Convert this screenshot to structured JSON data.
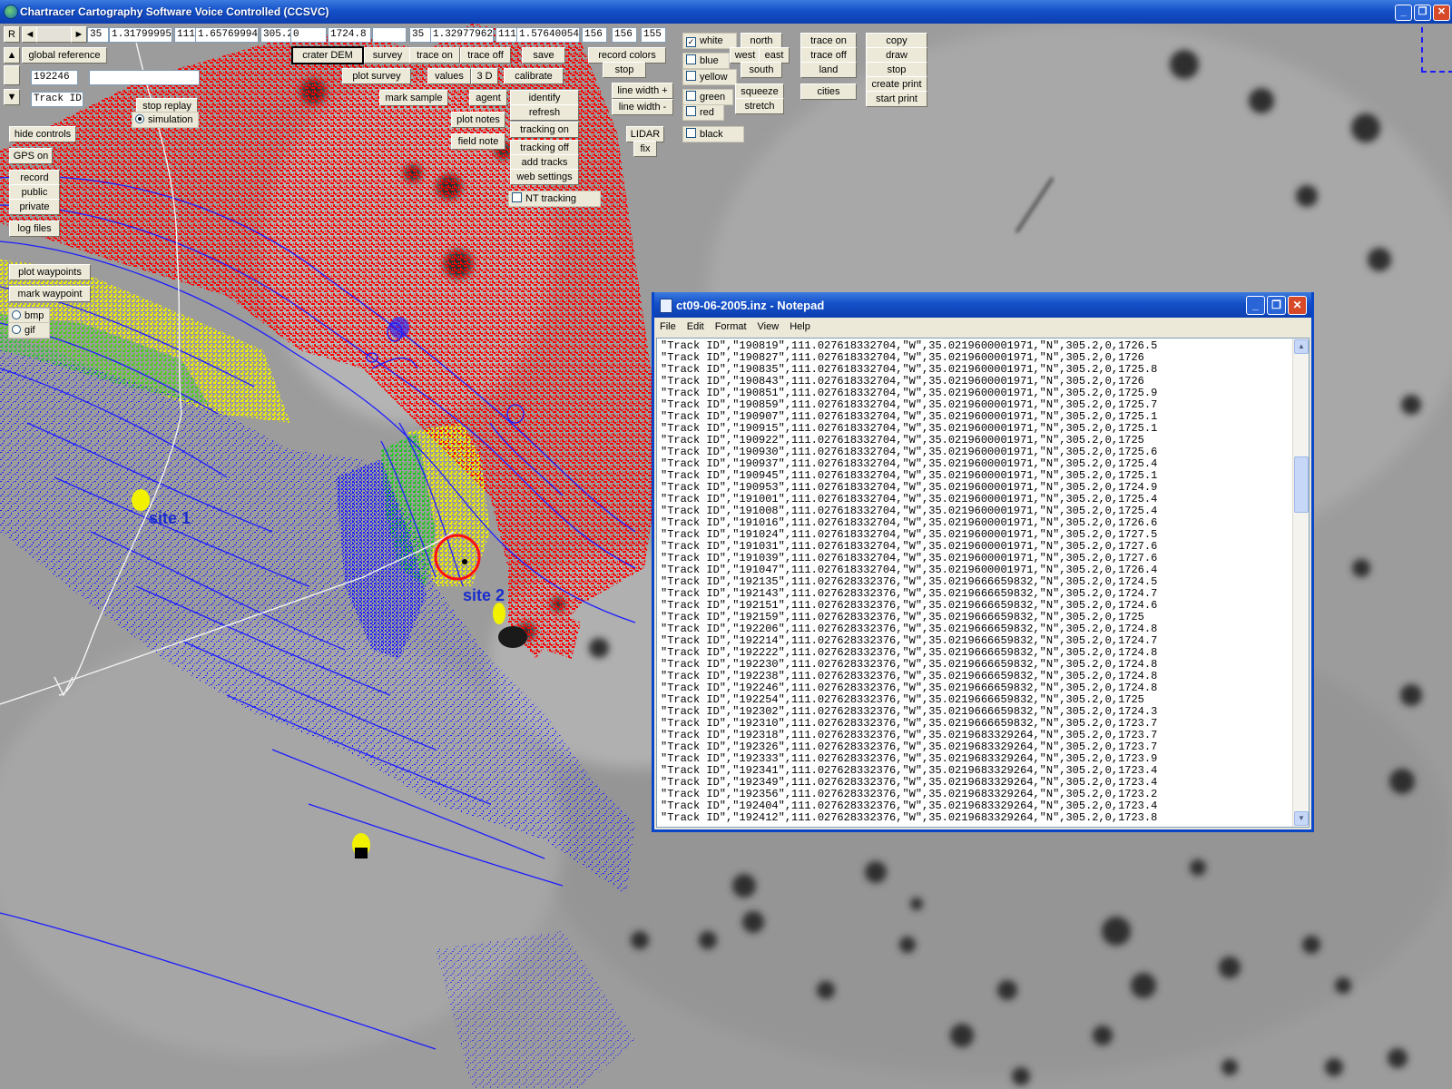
{
  "window": {
    "title": "Chartracer Cartography Software Voice Controlled (CCSVC)",
    "controls": [
      "_",
      "❐",
      "✕"
    ]
  },
  "coords_row": {
    "r_label": "R",
    "left_arrow": "◄",
    "right_arrow": "►",
    "f1": "35",
    "f2": "1.31799995",
    "f3": "111",
    "f4": "1.65769994",
    "f5": "305.2",
    "f6": "0",
    "f7": "1724.8",
    "f8": "",
    "f9": "35",
    "f10": "1.32977962",
    "f11": "111",
    "f12": "1.57640054",
    "f13": "156",
    "f14": "156",
    "f15": "155"
  },
  "left_panel": {
    "global_reference": "global reference",
    "track_number": "192246",
    "track_id": "Track ID",
    "track_note": "",
    "up_arrow": "▲",
    "down_arrow": "▼",
    "stop_replay": "stop replay",
    "simulation": "simulation",
    "hide_controls": "hide controls",
    "gps_on": "GPS on",
    "record": "record",
    "public": "public",
    "private": "private",
    "log_files": "log files",
    "plot_waypoints": "plot waypoints",
    "mark_waypoint": "mark waypoint",
    "bmp": "bmp",
    "gif": "gif"
  },
  "toolbar": {
    "crater_dem": "crater DEM",
    "survey": "survey",
    "trace_on": "trace on",
    "trace_off": "trace off",
    "save": "save",
    "record_colors": "record colors",
    "stop": "stop",
    "plot_survey": "plot survey",
    "values": "values",
    "three_d": "3 D",
    "calibrate": "calibrate",
    "mark_sample": "mark sample",
    "agent": "agent",
    "identify": "identify",
    "refresh": "refresh",
    "plot_notes": "plot notes",
    "tracking_on": "tracking on",
    "field_note": "field note",
    "tracking_off": "tracking off",
    "add_tracks": "add  tracks",
    "web_settings": "web settings",
    "nt_tracking": "NT tracking",
    "line_width_plus": "line width +",
    "line_width_minus": "line width -",
    "lidar": "LIDAR",
    "fix": "fix",
    "white": "white",
    "blue": "blue",
    "yellow": "yellow",
    "green": "green",
    "red": "red",
    "black": "black",
    "north": "north",
    "west": "west",
    "east": "east",
    "south": "south",
    "squeeze": "squeeze",
    "stretch": "stretch",
    "trace_on_2": "trace on",
    "trace_off_2": "trace off",
    "land": "land",
    "cities": "cities",
    "copy": "copy",
    "draw": "draw",
    "stop_2": "stop",
    "create_print": "create print",
    "start_print": "start print"
  },
  "map": {
    "site1": "site 1",
    "site2": "site 2"
  },
  "notepad": {
    "title": "ct09-06-2005.inz - Notepad",
    "menu": [
      "File",
      "Edit",
      "Format",
      "View",
      "Help"
    ],
    "lines": [
      "\"Track ID\",\"190819\",111.027618332704,\"W\",35.0219600001971,\"N\",305.2,0,1726.5",
      "\"Track ID\",\"190827\",111.027618332704,\"W\",35.0219600001971,\"N\",305.2,0,1726",
      "\"Track ID\",\"190835\",111.027618332704,\"W\",35.0219600001971,\"N\",305.2,0,1725.8",
      "\"Track ID\",\"190843\",111.027618332704,\"W\",35.0219600001971,\"N\",305.2,0,1726",
      "\"Track ID\",\"190851\",111.027618332704,\"W\",35.0219600001971,\"N\",305.2,0,1725.9",
      "\"Track ID\",\"190859\",111.027618332704,\"W\",35.0219600001971,\"N\",305.2,0,1725.7",
      "\"Track ID\",\"190907\",111.027618332704,\"W\",35.0219600001971,\"N\",305.2,0,1725.1",
      "\"Track ID\",\"190915\",111.027618332704,\"W\",35.0219600001971,\"N\",305.2,0,1725.1",
      "\"Track ID\",\"190922\",111.027618332704,\"W\",35.0219600001971,\"N\",305.2,0,1725",
      "\"Track ID\",\"190930\",111.027618332704,\"W\",35.0219600001971,\"N\",305.2,0,1725.6",
      "\"Track ID\",\"190937\",111.027618332704,\"W\",35.0219600001971,\"N\",305.2,0,1725.4",
      "\"Track ID\",\"190945\",111.027618332704,\"W\",35.0219600001971,\"N\",305.2,0,1725.1",
      "\"Track ID\",\"190953\",111.027618332704,\"W\",35.0219600001971,\"N\",305.2,0,1724.9",
      "\"Track ID\",\"191001\",111.027618332704,\"W\",35.0219600001971,\"N\",305.2,0,1725.4",
      "\"Track ID\",\"191008\",111.027618332704,\"W\",35.0219600001971,\"N\",305.2,0,1725.4",
      "\"Track ID\",\"191016\",111.027618332704,\"W\",35.0219600001971,\"N\",305.2,0,1726.6",
      "\"Track ID\",\"191024\",111.027618332704,\"W\",35.0219600001971,\"N\",305.2,0,1727.5",
      "\"Track ID\",\"191031\",111.027618332704,\"W\",35.0219600001971,\"N\",305.2,0,1727.6",
      "\"Track ID\",\"191039\",111.027618332704,\"W\",35.0219600001971,\"N\",305.2,0,1727.6",
      "\"Track ID\",\"191047\",111.027618332704,\"W\",35.0219600001971,\"N\",305.2,0,1726.4",
      "\"Track ID\",\"192135\",111.027628332376,\"W\",35.0219666659832,\"N\",305.2,0,1724.5",
      "\"Track ID\",\"192143\",111.027628332376,\"W\",35.0219666659832,\"N\",305.2,0,1724.7",
      "\"Track ID\",\"192151\",111.027628332376,\"W\",35.0219666659832,\"N\",305.2,0,1724.6",
      "\"Track ID\",\"192159\",111.027628332376,\"W\",35.0219666659832,\"N\",305.2,0,1725",
      "\"Track ID\",\"192206\",111.027628332376,\"W\",35.0219666659832,\"N\",305.2,0,1724.8",
      "\"Track ID\",\"192214\",111.027628332376,\"W\",35.0219666659832,\"N\",305.2,0,1724.7",
      "\"Track ID\",\"192222\",111.027628332376,\"W\",35.0219666659832,\"N\",305.2,0,1724.8",
      "\"Track ID\",\"192230\",111.027628332376,\"W\",35.0219666659832,\"N\",305.2,0,1724.8",
      "\"Track ID\",\"192238\",111.027628332376,\"W\",35.0219666659832,\"N\",305.2,0,1724.8",
      "\"Track ID\",\"192246\",111.027628332376,\"W\",35.0219666659832,\"N\",305.2,0,1724.8",
      "\"Track ID\",\"192254\",111.027628332376,\"W\",35.0219666659832,\"N\",305.2,0,1725",
      "\"Track ID\",\"192302\",111.027628332376,\"W\",35.0219666659832,\"N\",305.2,0,1724.3",
      "\"Track ID\",\"192310\",111.027628332376,\"W\",35.0219666659832,\"N\",305.2,0,1723.7",
      "\"Track ID\",\"192318\",111.027628332376,\"W\",35.0219683329264,\"N\",305.2,0,1723.7",
      "\"Track ID\",\"192326\",111.027628332376,\"W\",35.0219683329264,\"N\",305.2,0,1723.7",
      "\"Track ID\",\"192333\",111.027628332376,\"W\",35.0219683329264,\"N\",305.2,0,1723.9",
      "\"Track ID\",\"192341\",111.027628332376,\"W\",35.0219683329264,\"N\",305.2,0,1723.4",
      "\"Track ID\",\"192349\",111.027628332376,\"W\",35.0219683329264,\"N\",305.2,0,1723.4",
      "\"Track ID\",\"192356\",111.027628332376,\"W\",35.0219683329264,\"N\",305.2,0,1723.2",
      "\"Track ID\",\"192404\",111.027628332376,\"W\",35.0219683329264,\"N\",305.2,0,1723.4",
      "\"Track ID\",\"192412\",111.027628332376,\"W\",35.0219683329264,\"N\",305.2,0,1723.8"
    ]
  },
  "colors": {
    "titlebar": "#1450c8",
    "survey_red": "#ff0000",
    "survey_blue": "#1c1cff",
    "survey_yellow": "#f2f200",
    "survey_green": "#22c022"
  }
}
